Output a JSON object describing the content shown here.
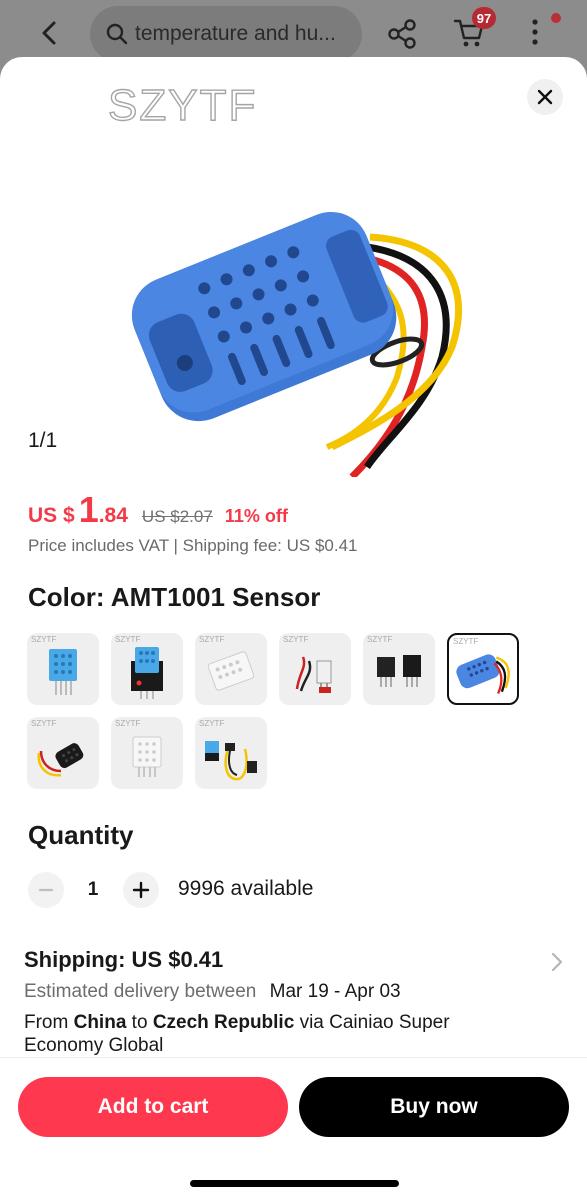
{
  "topbar": {
    "search_text": "temperature and hu...",
    "cart_badge": "97"
  },
  "sheet": {
    "brand": "SZYTF",
    "image_counter": "1/1"
  },
  "price": {
    "currency": "US $",
    "integer": "1",
    "decimal": ".84",
    "original": "US $2.07",
    "discount": "11% off",
    "note": "Price includes VAT | Shipping fee: US $0.41"
  },
  "color": {
    "title": "Color: AMT1001 Sensor",
    "swatch_brand": "SZYTF",
    "options": [
      {
        "name": "DHT11 module",
        "selected": false
      },
      {
        "name": "DHT11 board",
        "selected": false
      },
      {
        "name": "DHT22 white",
        "selected": false
      },
      {
        "name": "probe with wires",
        "selected": false
      },
      {
        "name": "black modules",
        "selected": false
      },
      {
        "name": "AMT1001 Sensor",
        "selected": true
      },
      {
        "name": "black probe with wires",
        "selected": false
      },
      {
        "name": "white sensor",
        "selected": false
      },
      {
        "name": "module with cable",
        "selected": false
      }
    ]
  },
  "quantity": {
    "title": "Quantity",
    "value": "1",
    "available": "9996 available"
  },
  "shipping": {
    "title": "Shipping: US $0.41",
    "est_label": "Estimated delivery between",
    "est_dates": "Mar 19 - Apr 03",
    "from_word": "From",
    "from_country": "China",
    "to_word": "to",
    "to_country": "Czech Republic",
    "via_text": "via Cainiao Super Economy Global"
  },
  "actions": {
    "add_to_cart": "Add to cart",
    "buy_now": "Buy now"
  },
  "colors": {
    "accent_red": "#fd384f",
    "price_red": "#f23a49",
    "sensor_blue": "#3f79d6"
  }
}
